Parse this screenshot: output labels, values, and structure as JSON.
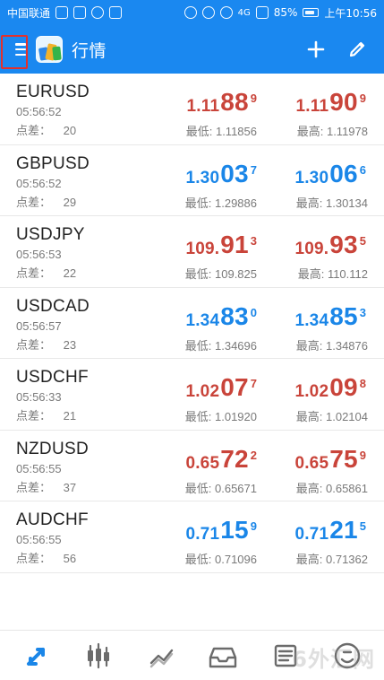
{
  "status_bar": {
    "carrier": "中国联通",
    "battery_percent": "85%",
    "network": "4G",
    "time": "上午10:56"
  },
  "app_bar": {
    "title": "行情",
    "icons": {
      "menu": "menu-icon",
      "logo": "mt-logo-icon",
      "add": "plus-icon",
      "edit": "pencil-icon"
    }
  },
  "labels": {
    "spread": "点差：",
    "low": "最低:",
    "high": "最高:"
  },
  "colors": {
    "brand": "#1a88f0",
    "up_blue": "#1a86e8",
    "down_red": "#c9443a",
    "highlight": "#e2312d"
  },
  "quotes": [
    {
      "symbol": "EURUSD",
      "time": "05:56:52",
      "spread": "20",
      "bid_main": "1.11",
      "bid_big": "88",
      "bid_sup": "9",
      "ask_main": "1.11",
      "ask_big": "90",
      "ask_sup": "9",
      "low": "1.11856",
      "high": "1.11978",
      "color": "#c9443a"
    },
    {
      "symbol": "GBPUSD",
      "time": "05:56:52",
      "spread": "29",
      "bid_main": "1.30",
      "bid_big": "03",
      "bid_sup": "7",
      "ask_main": "1.30",
      "ask_big": "06",
      "ask_sup": "6",
      "low": "1.29886",
      "high": "1.30134",
      "color": "#1a86e8"
    },
    {
      "symbol": "USDJPY",
      "time": "05:56:53",
      "spread": "22",
      "bid_main": "109.",
      "bid_big": "91",
      "bid_sup": "3",
      "ask_main": "109.",
      "ask_big": "93",
      "ask_sup": "5",
      "low": "109.825",
      "high": "110.112",
      "color": "#c9443a"
    },
    {
      "symbol": "USDCAD",
      "time": "05:56:57",
      "spread": "23",
      "bid_main": "1.34",
      "bid_big": "83",
      "bid_sup": "0",
      "ask_main": "1.34",
      "ask_big": "85",
      "ask_sup": "3",
      "low": "1.34696",
      "high": "1.34876",
      "color": "#1a86e8"
    },
    {
      "symbol": "USDCHF",
      "time": "05:56:33",
      "spread": "21",
      "bid_main": "1.02",
      "bid_big": "07",
      "bid_sup": "7",
      "ask_main": "1.02",
      "ask_big": "09",
      "ask_sup": "8",
      "low": "1.01920",
      "high": "1.02104",
      "color": "#c9443a"
    },
    {
      "symbol": "NZDUSD",
      "time": "05:56:55",
      "spread": "37",
      "bid_main": "0.65",
      "bid_big": "72",
      "bid_sup": "2",
      "ask_main": "0.65",
      "ask_big": "75",
      "ask_sup": "9",
      "low": "0.65671",
      "high": "0.65861",
      "color": "#c9443a"
    },
    {
      "symbol": "AUDCHF",
      "time": "05:56:55",
      "spread": "56",
      "bid_main": "0.71",
      "bid_big": "15",
      "bid_sup": "9",
      "ask_main": "0.71",
      "ask_big": "21",
      "ask_sup": "5",
      "low": "0.71096",
      "high": "0.71362",
      "color": "#1a86e8"
    }
  ],
  "bottom_nav": {
    "items": [
      {
        "icon": "quotes-arrows-icon",
        "active": true
      },
      {
        "icon": "candles-chart-icon",
        "active": false
      },
      {
        "icon": "trade-line-icon",
        "active": false
      },
      {
        "icon": "inbox-icon",
        "active": false
      },
      {
        "icon": "news-icon",
        "active": false
      },
      {
        "icon": "forex-logo-icon",
        "active": false
      }
    ]
  },
  "watermark": {
    "text": "6外汇网"
  }
}
